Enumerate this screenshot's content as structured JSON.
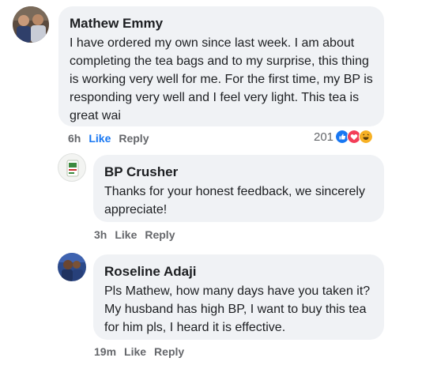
{
  "comments": [
    {
      "author": "Mathew Emmy",
      "text": "I have ordered my own since last week. I am about completing the tea bags and to my surprise,  this thing is working very well for me. For the first time, my BP is responding very well and I feel very light. This tea is great wai",
      "time": "6h",
      "like_label": "Like",
      "reply_label": "Reply",
      "reaction_count": "201"
    },
    {
      "author": "BP Crusher",
      "text": "Thanks for your honest feedback,  we sincerely appreciate!",
      "time": "3h",
      "like_label": "Like",
      "reply_label": "Reply"
    },
    {
      "author": "Roseline Adaji",
      "text": "Pls Mathew, how many days have you taken it? My husband has high BP, I want to buy this tea for him pls, I heard it is effective.",
      "time": "19m",
      "like_label": "Like",
      "reply_label": "Reply"
    }
  ],
  "colors": {
    "like_active": "#1877f2",
    "bubble_bg": "#f0f2f5",
    "meta_text": "#65676b",
    "reaction_like": "#1877f2",
    "reaction_love": "#f33e58",
    "reaction_haha": "#f7b125"
  }
}
